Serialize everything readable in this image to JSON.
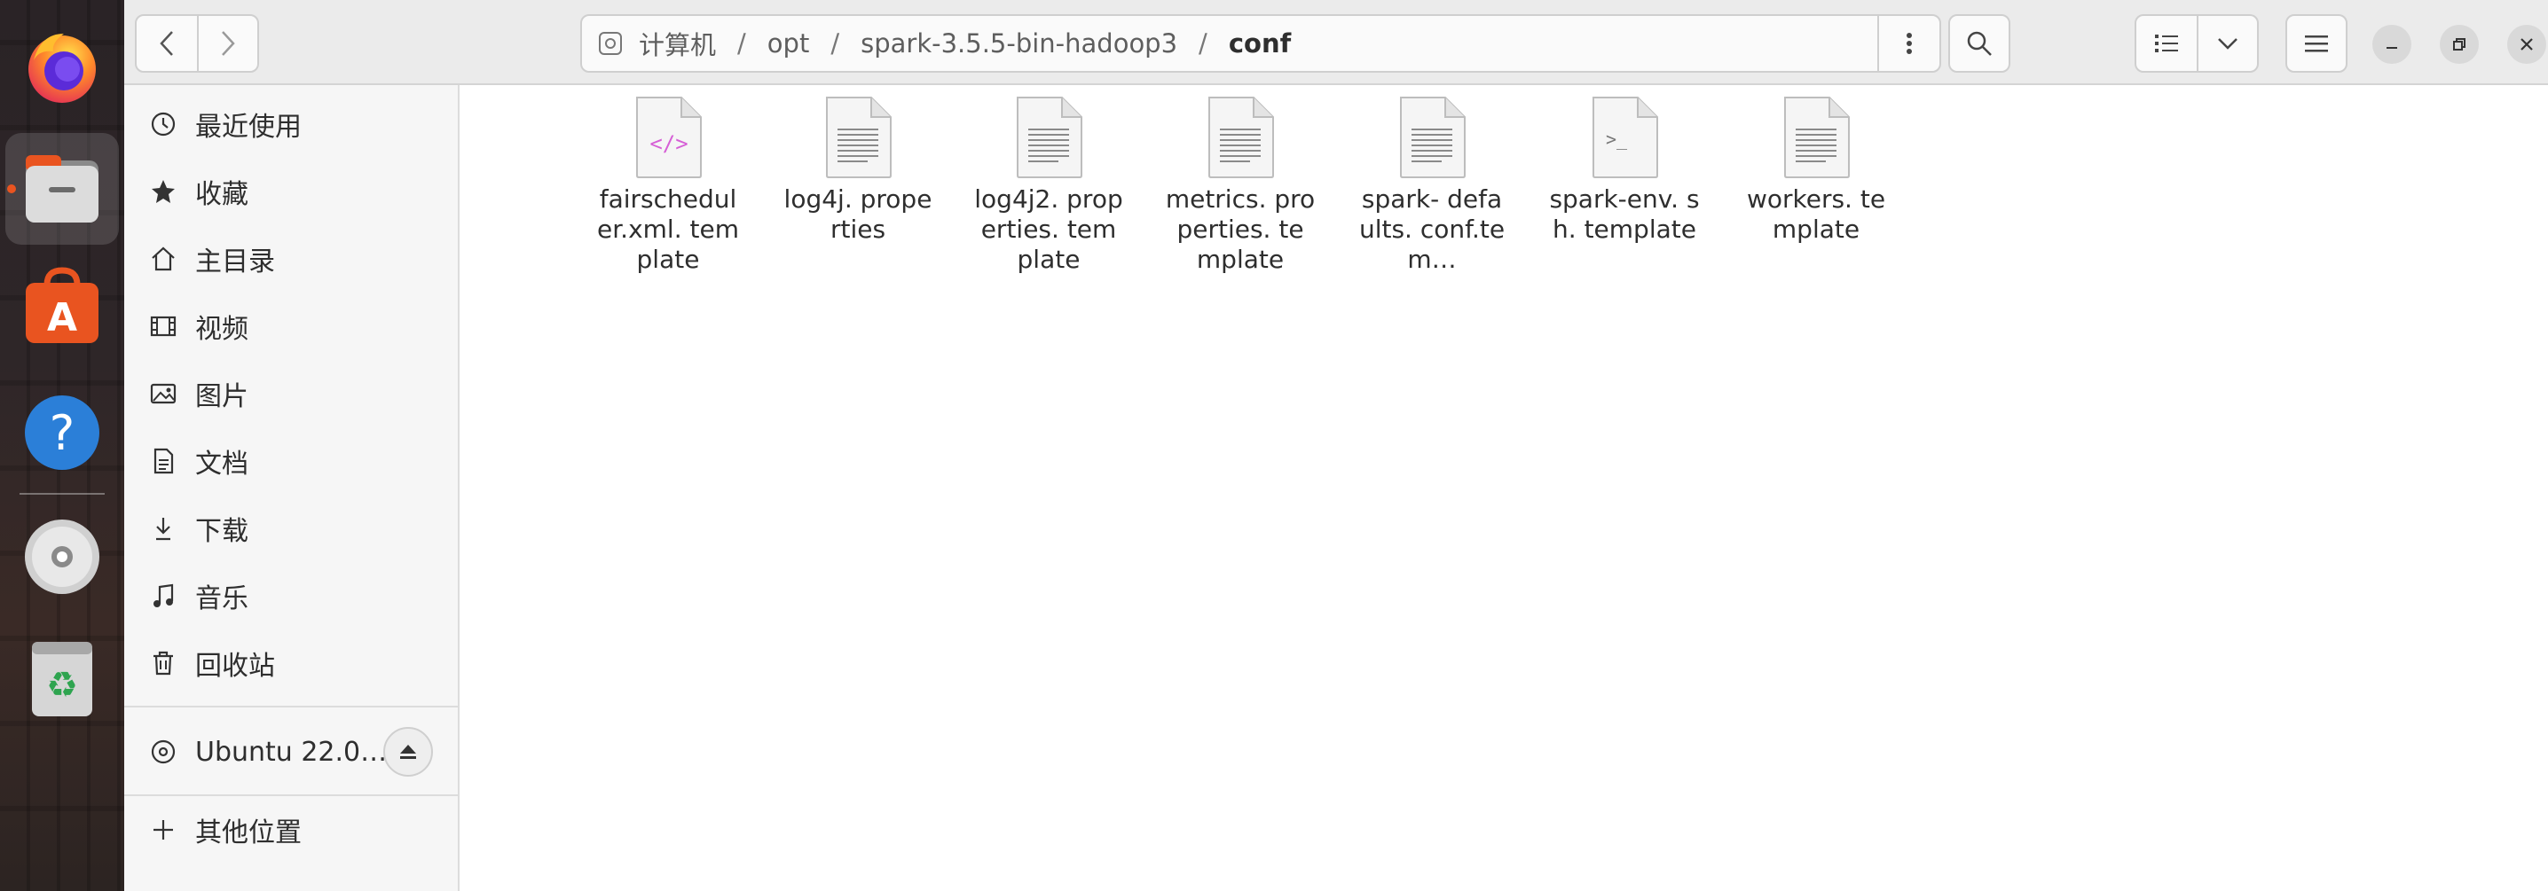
{
  "pathbar": {
    "location_root": "计算机",
    "crumbs": [
      "opt",
      "spark-3.5.5-bin-hadoop3"
    ],
    "current": "conf",
    "separator": "/"
  },
  "sidebar": {
    "items": [
      {
        "label": "最近使用",
        "icon": "clock-icon"
      },
      {
        "label": "收藏",
        "icon": "star-icon"
      },
      {
        "label": "主目录",
        "icon": "home-icon"
      },
      {
        "label": "视频",
        "icon": "film-icon"
      },
      {
        "label": "图片",
        "icon": "image-icon"
      },
      {
        "label": "文档",
        "icon": "document-icon"
      },
      {
        "label": "下载",
        "icon": "download-icon"
      },
      {
        "label": "音乐",
        "icon": "music-icon"
      },
      {
        "label": "回收站",
        "icon": "trash-icon"
      }
    ],
    "device": {
      "label": "Ubuntu 22.0…",
      "icon": "disc-icon"
    },
    "other": {
      "label": "其他位置",
      "icon": "plus-icon"
    }
  },
  "files": [
    {
      "name": "fairschedul er.xml. template",
      "type": "xml"
    },
    {
      "name": "log4j. properties",
      "type": "text"
    },
    {
      "name": "log4j2. properties. template",
      "type": "text"
    },
    {
      "name": "metrics. properties. template",
      "type": "text"
    },
    {
      "name": "spark- defaults. conf.tem…",
      "type": "text"
    },
    {
      "name": "spark-env. sh. template",
      "type": "script"
    },
    {
      "name": "workers. template",
      "type": "text"
    }
  ],
  "dock": [
    "firefox-icon",
    "files-icon",
    "app-center-icon",
    "help-icon",
    "dvd-icon",
    "trash-icon"
  ],
  "colors": {
    "accent": "#e95420",
    "xml_tag": "#d65fd6"
  }
}
